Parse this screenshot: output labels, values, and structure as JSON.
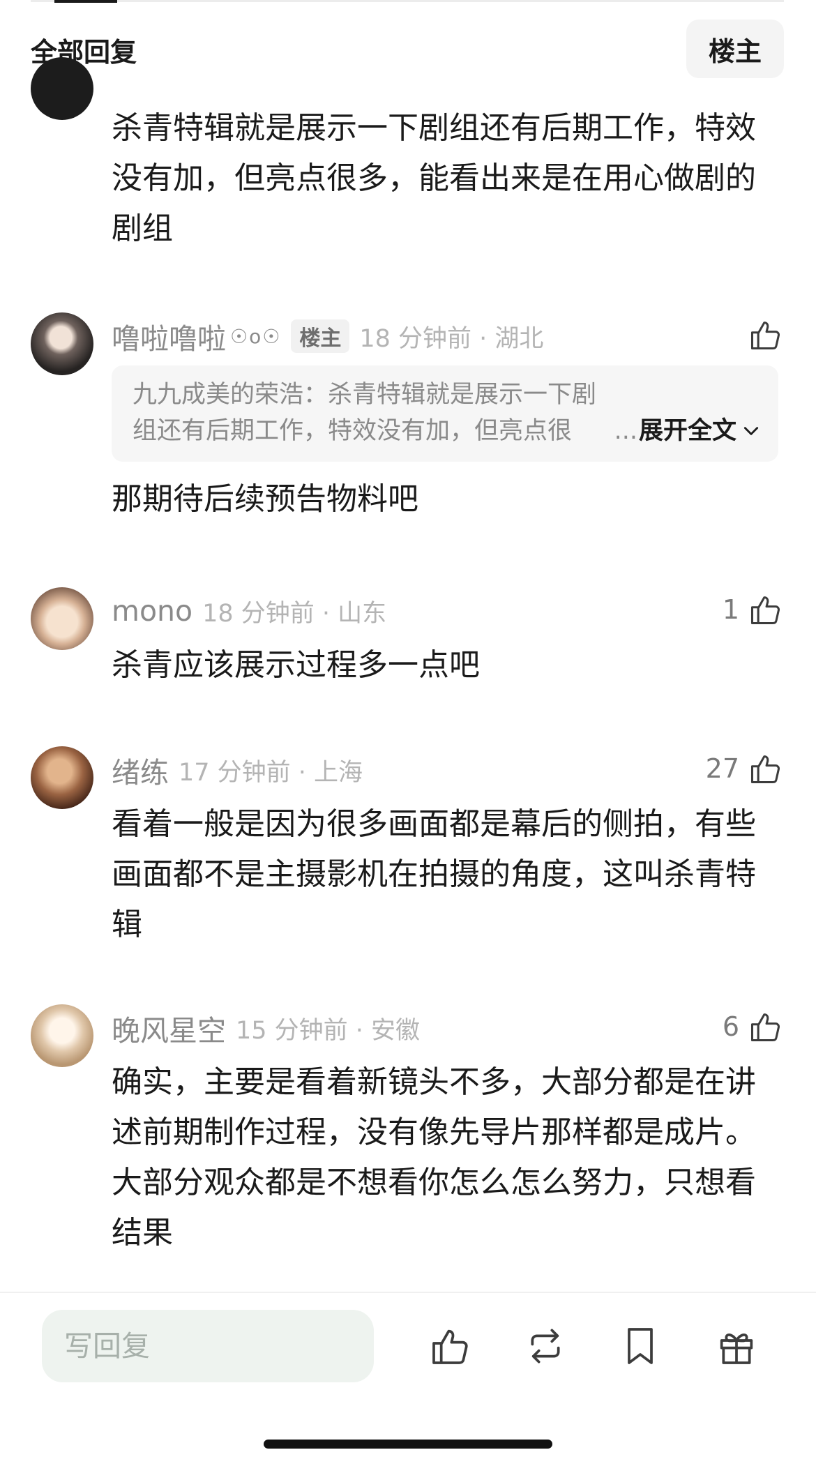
{
  "header": {
    "title": "全部回复",
    "host_filter_label": "楼主"
  },
  "first_comment_continued": {
    "text": "杀青特辑就是展示一下剧组还有后期工作，特效没有加，但亮点很多，能看出来是在用心做剧的剧组"
  },
  "comments": [
    {
      "username": "噜啦噜啦",
      "user_badge": "☉ᴏ☉",
      "host_badge": "楼主",
      "time_location": "18 分钟前 · 湖北",
      "likes": "",
      "quote": {
        "text": "九九成美的荣浩：杀青特辑就是展示一下剧组还有后期工作，特效没有加，但亮点很多，",
        "ellipsis": "...",
        "expand_label": "展开全文"
      },
      "text": "那期待后续预告物料吧"
    },
    {
      "username": "mono",
      "time_location": "18 分钟前 · 山东",
      "likes": "1",
      "text": "杀青应该展示过程多一点吧"
    },
    {
      "username": "绪练",
      "time_location": "17 分钟前 · 上海",
      "likes": "27",
      "text": "看着一般是因为很多画面都是幕后的侧拍，有些画面都不是主摄影机在拍摄的角度，这叫杀青特辑"
    },
    {
      "username": "晚风星空",
      "time_location": "15 分钟前 · 安徽",
      "likes": "6",
      "text": "确实，主要是看着新镜头不多，大部分都是在讲述前期制作过程，没有像先导片那样都是成片。大部分观众都是不想看你怎么怎么努力，只想看结果"
    }
  ],
  "bottom_bar": {
    "reply_placeholder": "写回复",
    "icons": [
      "like-icon",
      "repost-icon",
      "bookmark-icon",
      "gift-icon"
    ]
  },
  "colors": {
    "text": "#1a1a1a",
    "meta": "#8a8a8a",
    "time": "#b4b4b4",
    "input_bg": "#eef3ef",
    "quote_bg": "#f6f6f6"
  }
}
